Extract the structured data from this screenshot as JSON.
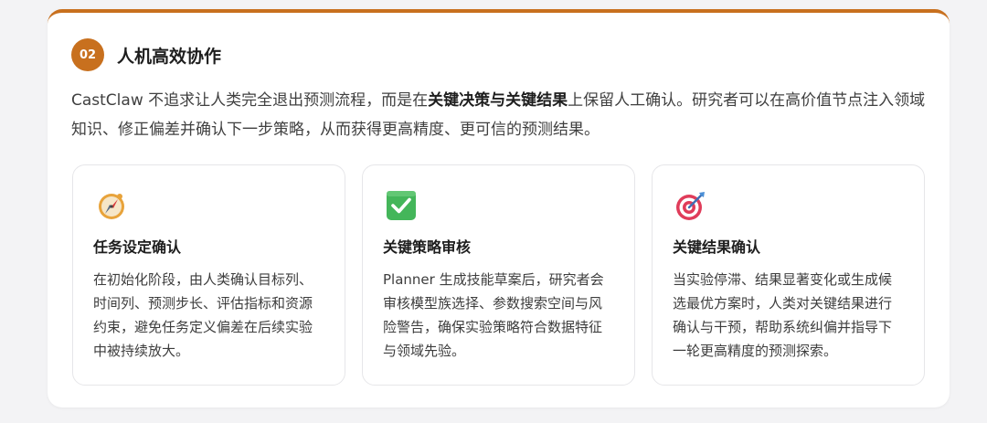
{
  "section": {
    "number": "02",
    "title": "人机高效协作",
    "intro_before": "CastClaw 不追求让人类完全退出预测流程，而是在",
    "intro_bold": "关键决策与关键结果",
    "intro_after": "上保留人工确认。研究者可以在高价值节点注入领域知识、修正偏差并确认下一步策略，从而获得更高精度、更可信的预测结果。",
    "accent_color": "#c8701e"
  },
  "cards": [
    {
      "icon": "compass-icon",
      "title": "任务设定确认",
      "description": "在初始化阶段，由人类确认目标列、时间列、预测步长、评估指标和资源约束，避免任务定义偏差在后续实验中被持续放大。"
    },
    {
      "icon": "check-mark-button-icon",
      "title": "关键策略审核",
      "description": "Planner 生成技能草案后，研究者会审核模型族选择、参数搜索空间与风险警告，确保实验策略符合数据特征与领域先验。"
    },
    {
      "icon": "target-dart-icon",
      "title": "关键结果确认",
      "description": "当实验停滞、结果显著变化或生成候选最优方案时，人类对关键结果进行确认与干预，帮助系统纠偏并指导下一轮更高精度的预测探索。"
    }
  ]
}
